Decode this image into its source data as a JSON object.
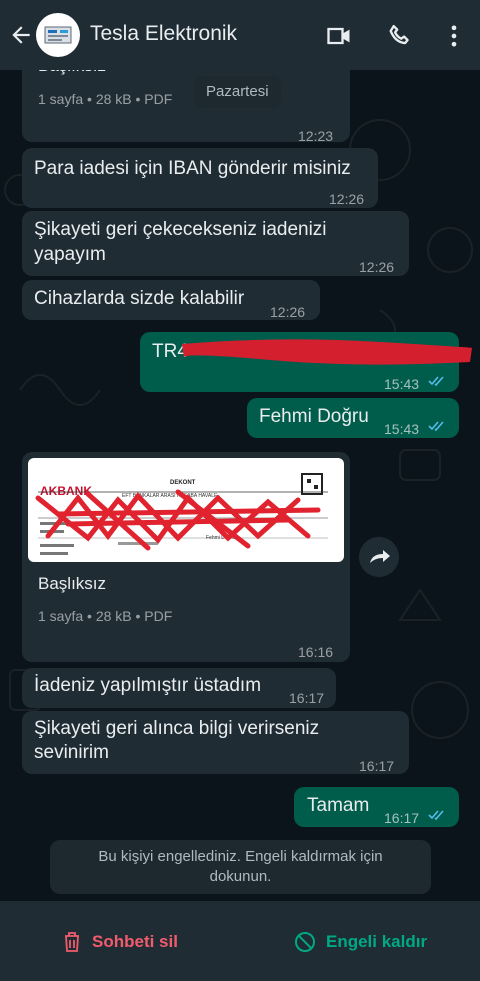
{
  "header": {
    "title": "Tesla Elektronik",
    "icons": [
      "back-arrow-icon",
      "video-call-icon",
      "phone-icon",
      "more-vert-icon"
    ]
  },
  "date_divider": "Pazartesi",
  "messages": [
    {
      "id": "doc1",
      "direction": "in",
      "doc_title": "Başlıksız",
      "doc_meta": "1 sayfa • 28 kB • PDF",
      "time": "12:23"
    },
    {
      "id": "m1",
      "direction": "in",
      "text": "Para iadesi için IBAN gönderir misiniz",
      "time": "12:26"
    },
    {
      "id": "m2",
      "direction": "in",
      "line1": "Şikayeti geri çekecekseniz iadenizi",
      "line2": "yapayım",
      "time": "12:26"
    },
    {
      "id": "m3",
      "direction": "in",
      "text": "Cihazlarda sizde kalabilir",
      "time": "12:26"
    },
    {
      "id": "m4",
      "direction": "out",
      "text": "TR4",
      "time": "15:43",
      "status": "read"
    },
    {
      "id": "m5",
      "direction": "out",
      "text": "Fehmi Doğru",
      "time": "15:43",
      "status": "read"
    },
    {
      "id": "doc2",
      "direction": "in",
      "doc_title": "Başlıksız",
      "doc_meta": "1 sayfa • 28 kB • PDF",
      "time": "16:16",
      "preview": {
        "bank": "AKBANK",
        "heading": "DEKONT",
        "subheading": "EFT BANKALAR ARASI HESABA HAVALE",
        "name": "Fehmi Doğru"
      }
    },
    {
      "id": "m6",
      "direction": "in",
      "text": "İadeniz yapılmıştır üstadım",
      "time": "16:17"
    },
    {
      "id": "m7",
      "direction": "in",
      "line1": "Şikayeti geri alınca bilgi verirseniz",
      "line2": "sevinirim",
      "time": "16:17"
    },
    {
      "id": "m8",
      "direction": "out",
      "text": "Tamam",
      "time": "16:17",
      "status": "read"
    }
  ],
  "blocked_notice": {
    "line1": "Bu kişiyi engellediniz. Engeli kaldırmak için",
    "line2": "dokunun."
  },
  "bottom_bar": {
    "delete_label": "Sohbeti sil",
    "unblock_label": "Engeli kaldır"
  },
  "colors": {
    "delete": "#f15c6d",
    "unblock": "#00a884",
    "read_ticks": "#53bdeb"
  }
}
